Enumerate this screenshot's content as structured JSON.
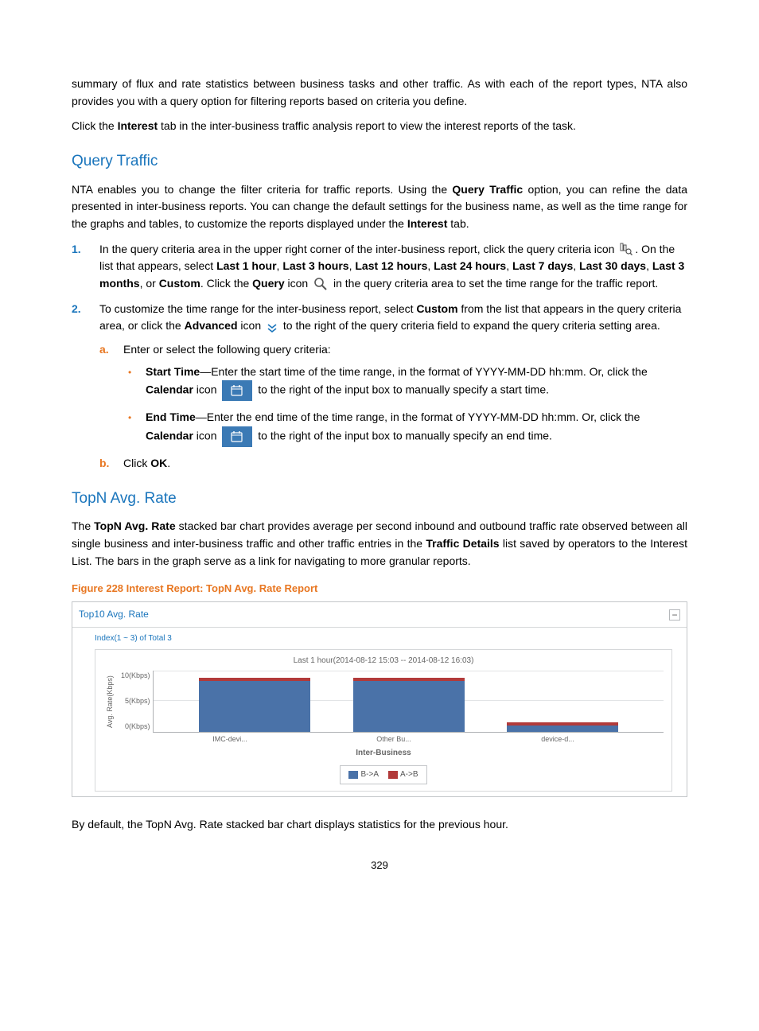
{
  "intro_p1": "summary of flux and rate statistics between business tasks and other traffic. As with each of the report types, NTA also provides you with a query option for filtering reports based on criteria you define.",
  "intro_p2_pre": "Click the ",
  "intro_p2_bold": "Interest",
  "intro_p2_post": " tab in the inter-business traffic analysis report to view the interest reports of the task.",
  "h_query": "Query Traffic",
  "qt_p1_a": "NTA enables you to change the filter criteria for traffic reports. Using the ",
  "qt_p1_b": "Query Traffic",
  "qt_p1_c": " option, you can refine the data presented in inter-business reports. You can change the default settings for the business name, as well as the time range for the graphs and tables, to customize the reports displayed under the ",
  "qt_p1_d": "Interest",
  "qt_p1_e": " tab.",
  "step1_a": "In the query criteria area in the upper right corner of the inter-business report, click the query criteria icon ",
  "step1_b": ". On the list that appears, select ",
  "opt1": "Last 1 hour",
  "sep": ", ",
  "opt2": "Last 3 hours",
  "opt3": "Last 12 hours",
  "opt4": "Last 24 hours",
  "opt5": "Last 7 days",
  "opt6": "Last 30 days",
  "opt7": "Last 3 months",
  "or": ", or ",
  "opt8": "Custom",
  "step1_c": ". Click the ",
  "step1_query": "Query",
  "step1_d": " icon ",
  "step1_e": " in the query criteria area to set the time range for the traffic report.",
  "step2_a": "To customize the time range for the inter-business report, select ",
  "step2_b": " from the list that appears in the query criteria area, or click the ",
  "step2_adv": "Advanced",
  "step2_c": " icon ",
  "step2_d": " to the right of the query criteria field to expand the query criteria setting area.",
  "sub_a": "Enter or select the following query criteria:",
  "bul1_a": "Start Time",
  "bul1_b": "—Enter the start time of the time range, in the format of YYYY-MM-DD hh:mm. Or, click the ",
  "cal": "Calendar",
  "bul1_c": " icon ",
  "bul1_d": " to the right of the input box to manually specify a start time.",
  "bul2_a": "End Time",
  "bul2_b": "—Enter the end time of the time range, in the format of YYYY-MM-DD hh:mm. Or, click the ",
  "bul2_d": " to the right of the input box to manually specify an end time.",
  "sub_b_a": "Click ",
  "sub_b_b": "OK",
  "sub_b_c": ".",
  "h_topn": "TopN Avg. Rate",
  "topn_p_a": "The ",
  "topn_p_b": "TopN Avg. Rate",
  "topn_p_c": " stacked bar chart provides average per second inbound and outbound traffic rate observed between all single business and inter-business traffic and other traffic entries in the ",
  "topn_p_d": "Traffic Details",
  "topn_p_e": " list saved by operators to the Interest List. The bars in the graph serve as a link for navigating to more granular reports.",
  "fig_caption": "Figure 228 Interest Report: TopN Avg. Rate Report",
  "after_chart": "By default, the TopN Avg. Rate stacked bar chart displays statistics for the previous hour.",
  "page_num": "329",
  "chart_data": {
    "type": "bar",
    "panel_title": "Top10 Avg. Rate",
    "index_text": "Index(1 ~ 3) of Total 3",
    "subtitle": "Last 1 hour(2014-08-12 15:03 -- 2014-08-12 16:03)",
    "ylabel": "Avg. Rate(Kbps)",
    "x_axis_title": "Inter-Business",
    "yticks": [
      "10(Kbps)",
      "5(Kbps)",
      "0(Kbps)"
    ],
    "ylim": [
      0,
      10
    ],
    "categories": [
      "IMC-devi...",
      "Other Bu...",
      "device-d..."
    ],
    "series": [
      {
        "name": "B->A",
        "color": "#4a72a8",
        "values": [
          8.3,
          8.3,
          1.0
        ]
      },
      {
        "name": "A->B",
        "color": "#b23a3a",
        "values": [
          0.5,
          0.5,
          0.5
        ]
      }
    ]
  }
}
